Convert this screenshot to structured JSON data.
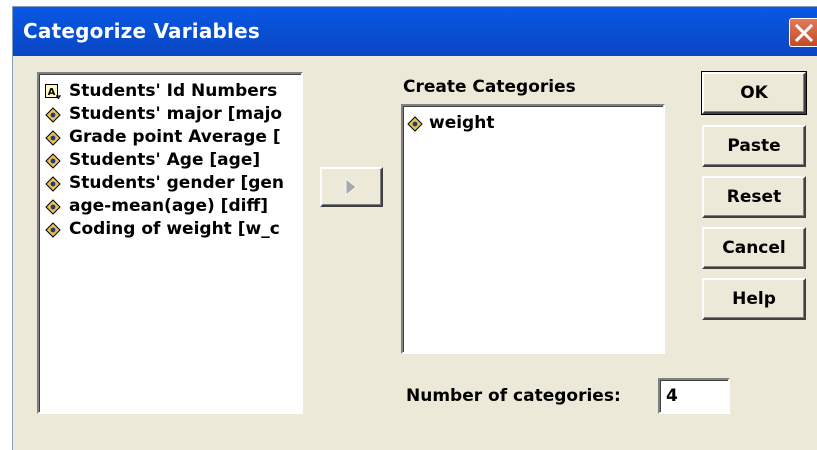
{
  "window": {
    "title": "Categorize Variables"
  },
  "variables": [
    {
      "label": "Students' Id Numbers",
      "icon": "string-variable-icon"
    },
    {
      "label": "Students' major [majo",
      "icon": "numeric-variable-icon"
    },
    {
      "label": "Grade point Average [",
      "icon": "numeric-variable-icon"
    },
    {
      "label": "Students' Age [age]",
      "icon": "numeric-variable-icon"
    },
    {
      "label": "Students' gender [gen",
      "icon": "numeric-variable-icon"
    },
    {
      "label": "age-mean(age) [diff]",
      "icon": "numeric-variable-icon"
    },
    {
      "label": "Coding of weight [w_c",
      "icon": "numeric-variable-icon"
    }
  ],
  "create_categories": {
    "label": "Create Categories",
    "items": [
      {
        "label": "weight",
        "icon": "numeric-variable-icon"
      }
    ]
  },
  "number_of_categories": {
    "label": "Number of categories:",
    "value": "4"
  },
  "buttons": {
    "ok": "OK",
    "paste": "Paste",
    "reset": "Reset",
    "cancel": "Cancel",
    "help": "Help"
  },
  "colors": {
    "titlebar": "#0850d3",
    "dialog_bg": "#ece9d8",
    "close": "#c44a26"
  }
}
